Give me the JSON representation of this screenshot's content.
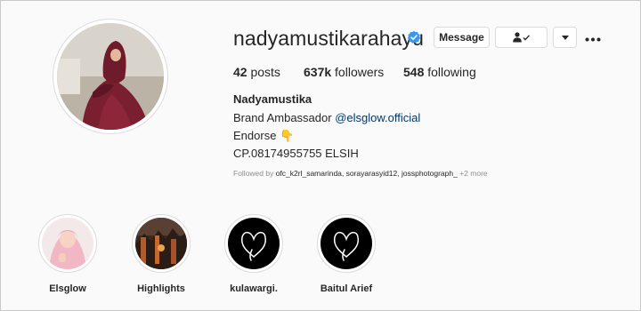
{
  "profile": {
    "username": "nadyamustikarahayu",
    "verified": true,
    "full_name": "Nadyamustika",
    "stats": {
      "posts_count": "42",
      "posts_label": "posts",
      "followers_count": "637k",
      "followers_label": "followers",
      "following_count": "548",
      "following_label": "following"
    },
    "bio": {
      "line1_prefix": "Brand Ambassador ",
      "line1_link": "@elsglow.official",
      "line2": "Endorse 👇",
      "line3": "CP.08174955755 ELSIH"
    },
    "followed_by": {
      "prefix": "Followed by ",
      "names": "ofc_k2rl_samarinda, sorayarasyid12, jossphotograph_",
      "suffix": " +2 more"
    }
  },
  "actions": {
    "message_label": "Message",
    "follow_icon": "person-check-icon",
    "caret_icon": "caret-down-icon",
    "more_icon": "more-options-icon"
  },
  "highlights": [
    {
      "label": "Elsglow"
    },
    {
      "label": "Highlights"
    },
    {
      "label": "kulawargi."
    },
    {
      "label": "Baitul Arief"
    }
  ],
  "colors": {
    "verified": "#3897f0",
    "link": "#00376b",
    "muted": "#8e8e8e",
    "dress": "#7a1f30"
  }
}
